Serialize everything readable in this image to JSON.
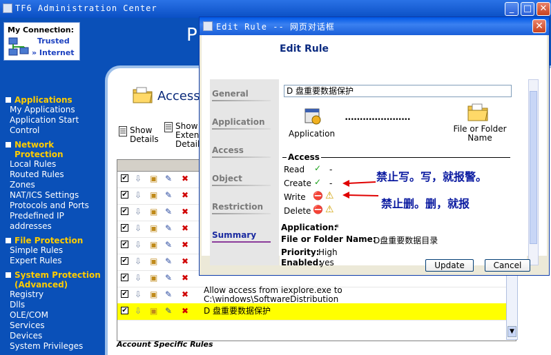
{
  "app": {
    "title": "TF6 Administration Center",
    "window_buttons": {
      "minimize": "_",
      "maximize": "□",
      "close": "✕"
    }
  },
  "sidebar": {
    "connection": {
      "title": "My Connection:",
      "trusted": "Trusted",
      "internet": "» Internet"
    },
    "sections": [
      {
        "title": "Applications",
        "items": [
          "My Applications",
          "Application Start Control"
        ]
      },
      {
        "title": "Network Protection",
        "items": [
          "Local Rules",
          "Routed Rules",
          "Zones",
          "NAT/ICS Settings",
          "Protocols and Ports",
          "Predefined IP addresses"
        ]
      },
      {
        "title": "File Protection",
        "items": [
          "Simple Rules",
          "Expert Rules"
        ]
      },
      {
        "title": "System Protection (Advanced)",
        "items": [
          "Registry",
          "Dlls",
          "OLE/COM",
          "Services",
          "Devices",
          "System Privileges"
        ]
      }
    ]
  },
  "content": {
    "header_letter": "P",
    "title": "Access",
    "toolbar": {
      "show_details": "Show Details",
      "show_extended": "Show Extended Details"
    },
    "rows": [
      {
        "text": "",
        "checked": "✔"
      },
      {
        "text": "",
        "checked": "✔"
      },
      {
        "text": "",
        "checked": "✔"
      },
      {
        "text": "",
        "checked": "✔"
      },
      {
        "text": "",
        "checked": "✔"
      },
      {
        "text": "",
        "checked": "✔"
      },
      {
        "text": "",
        "checked": "✔"
      },
      {
        "text": "Allow access from iexplore.exe to C:\\windows\\SoftwareDistribution",
        "checked": "✔"
      },
      {
        "text": "D 盘重要数据保护",
        "checked": "✔",
        "highlight": true
      }
    ],
    "account_rules": "Account Specific Rules"
  },
  "dialog": {
    "title": "Edit Rule -- 网页对话框",
    "close": "✕",
    "heading": "Edit Rule",
    "tabs": [
      "General",
      "Application",
      "Access",
      "Object",
      "Restriction",
      "Summary"
    ],
    "active_tab": "Summary",
    "summary": {
      "rule_name": "D 盘重要数据保护",
      "application_icon_label": "Application",
      "file_icon_label": "File or Folder Name",
      "dots": "••••••••••••••••••••••",
      "access_header": "Access",
      "access": [
        {
          "label": "Read",
          "status": "✓",
          "extra": "-"
        },
        {
          "label": "Create",
          "status": "✓",
          "extra": "-"
        },
        {
          "label": "Write",
          "status": "⛔",
          "extra": "⚠"
        },
        {
          "label": "Delete",
          "status": "⛔",
          "extra": "⚠"
        }
      ],
      "application_label": "Application:",
      "application_value": "*",
      "file_label": "File or Folder Name:",
      "file_value": "D盘重要数据目录",
      "priority_label": "Priority:",
      "priority_value": "High",
      "enabled_label": "Enabled:",
      "enabled_value": "yes"
    },
    "buttons": {
      "update": "Update",
      "cancel": "Cancel"
    }
  },
  "annotations": {
    "write_note": "禁止写。写，就报警。",
    "delete_note": "禁止删。删，就报"
  },
  "colors": {
    "accent_blue": "#0a50b8",
    "section_yellow": "#ffcc00",
    "highlight": "#ffff00",
    "annotation": "#0a1aa0",
    "arrow_red": "#e00000"
  }
}
